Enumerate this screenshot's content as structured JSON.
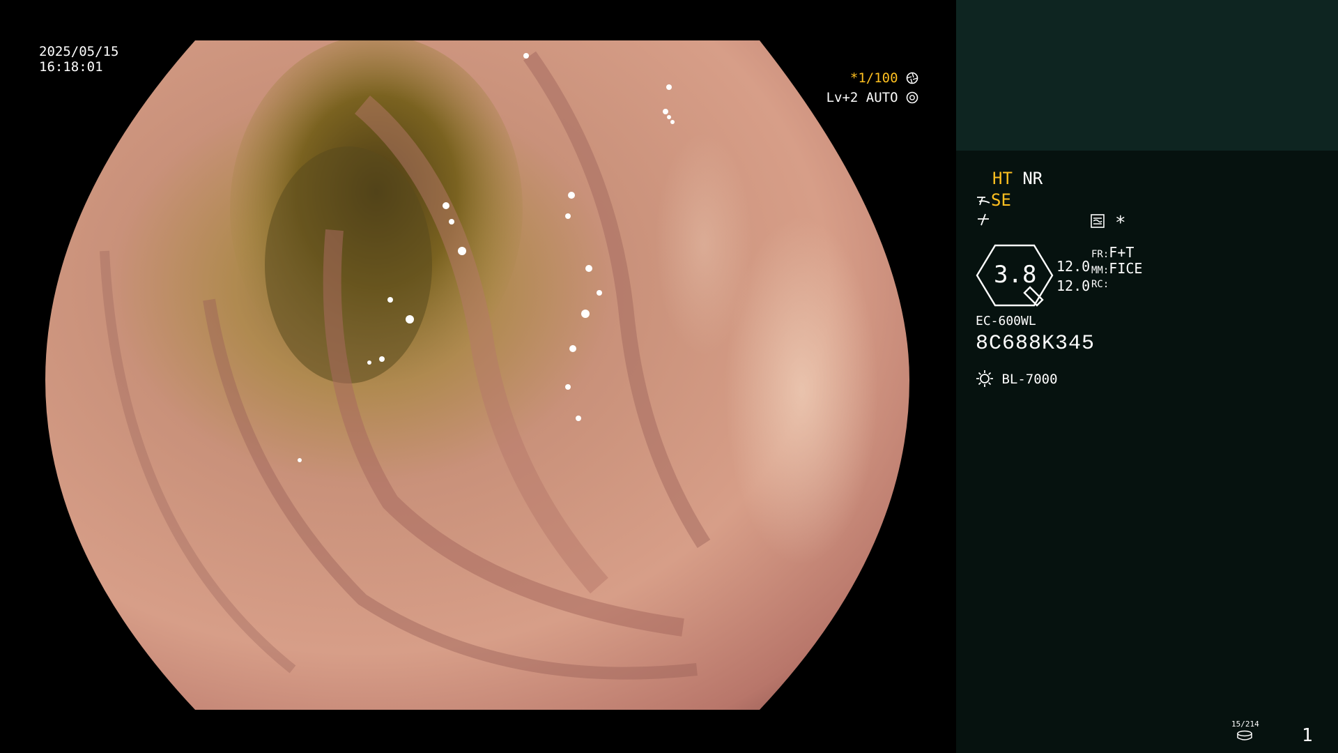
{
  "viewport": {
    "date": "2025/05/15",
    "time": "16:18:01",
    "shutter": "*1/100",
    "level": "Lv+2 AUTO",
    "shutter_icon": "aperture-icon",
    "auto_icon": "iris-icon"
  },
  "panel": {
    "ht": "HT",
    "nr": "NR",
    "se": "SE",
    "se_icon": "structure-enhance-icon",
    "color_icon": "color-mode-icon",
    "image_mode_icon": "image-mode-icon",
    "asterisk": "*",
    "zoom_value": "3.8",
    "zoom_icon": "zoom-badge-icon",
    "value_a": "12.0",
    "value_b": "12.0",
    "fr_label": "FR:",
    "fr_value": "F+T",
    "mm_label": "MM:",
    "mm_value": "FICE",
    "rc_label": "RC:",
    "scope_model": "EC-600WL",
    "serial": "8C688K345",
    "light_icon": "light-source-icon",
    "light_source": "BL-7000",
    "record_counter": "15/214",
    "record_icon": "storage-icon",
    "page_number": "1"
  },
  "colors": {
    "accent_yellow": "#ffc020",
    "panel_bg": "#06120f",
    "panel_top": "#0e2521"
  }
}
